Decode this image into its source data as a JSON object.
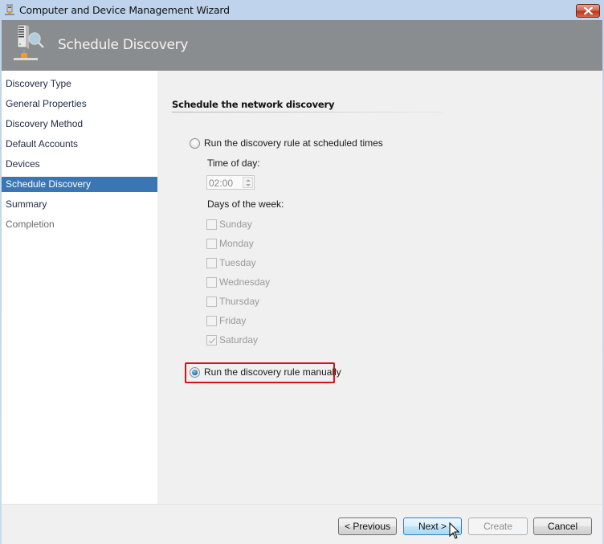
{
  "window": {
    "title": "Computer and Device Management Wizard",
    "close_icon": "close-x-icon"
  },
  "header": {
    "title": "Schedule Discovery",
    "icon": "server-discovery-icon"
  },
  "sidebar": {
    "items": [
      {
        "label": "Discovery Type",
        "state": "normal"
      },
      {
        "label": "General Properties",
        "state": "normal"
      },
      {
        "label": "Discovery Method",
        "state": "normal"
      },
      {
        "label": "Default Accounts",
        "state": "normal"
      },
      {
        "label": "Devices",
        "state": "normal"
      },
      {
        "label": "Schedule Discovery",
        "state": "active"
      },
      {
        "label": "Summary",
        "state": "normal"
      },
      {
        "label": "Completion",
        "state": "dim"
      }
    ]
  },
  "content": {
    "section_title": "Schedule the network discovery",
    "scheduled_option": {
      "label": "Run the discovery rule at scheduled times",
      "checked": false
    },
    "time_of_day_label": "Time of day:",
    "time_of_day_value": "02:00",
    "days_label": "Days of the week:",
    "days": [
      {
        "label": "Sunday",
        "checked": false
      },
      {
        "label": "Monday",
        "checked": false
      },
      {
        "label": "Tuesday",
        "checked": false
      },
      {
        "label": "Wednesday",
        "checked": false
      },
      {
        "label": "Thursday",
        "checked": false
      },
      {
        "label": "Friday",
        "checked": false
      },
      {
        "label": "Saturday",
        "checked": true
      }
    ],
    "manual_option": {
      "label": "Run the discovery rule manually",
      "checked": true
    },
    "highlight_color": "#d3121c"
  },
  "footer": {
    "previous_label": "< Previous",
    "next_label": "Next >",
    "create_label": "Create",
    "cancel_label": "Cancel"
  },
  "colors": {
    "header_bg": "#8a8d8f",
    "selection_bg": "#3b76b3",
    "window_frame": "#c6d9ee"
  }
}
